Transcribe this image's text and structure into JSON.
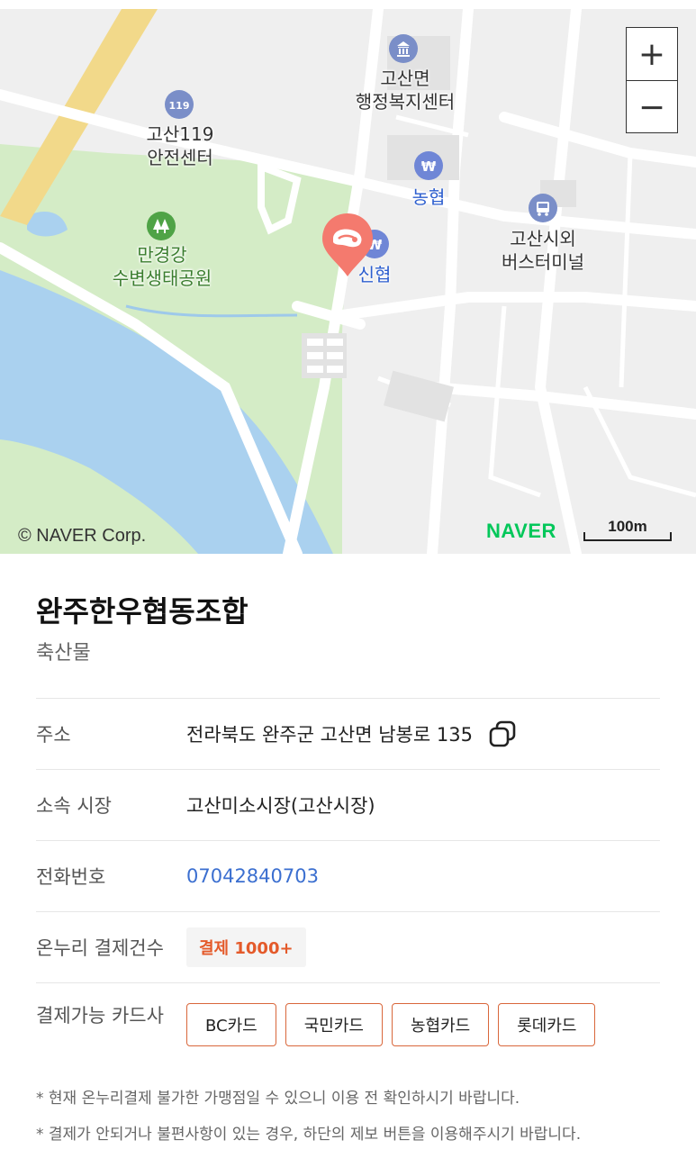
{
  "map": {
    "zoom_in_label": "+",
    "zoom_out_label": "−",
    "copyright": "© NAVER Corp.",
    "provider_logo": "NAVER",
    "scale_label": "100m",
    "pois": [
      {
        "id": "admin",
        "lines": [
          "고산면",
          "행정복지센터"
        ],
        "icon": "government-building-icon",
        "style": "normal"
      },
      {
        "id": "fire",
        "lines": [
          "고산119",
          "안전센터"
        ],
        "icon": "fire-station-icon",
        "style": "normal"
      },
      {
        "id": "park",
        "lines": [
          "만경강",
          "수변생태공원"
        ],
        "icon": "park-tree-icon",
        "style": "park"
      },
      {
        "id": "nh",
        "lines": [
          "농협"
        ],
        "icon": "bank-won-icon",
        "style": "blue"
      },
      {
        "id": "shinhyup",
        "lines": [
          "신협"
        ],
        "icon": "bank-icon",
        "style": "blue"
      },
      {
        "id": "bus",
        "lines": [
          "고산시외",
          "버스터미널"
        ],
        "icon": "bus-terminal-icon",
        "style": "normal"
      }
    ],
    "marker_icon": "meat-store-marker-icon",
    "colors": {
      "water": "#aad1ef",
      "park": "#d4ecc6",
      "road": "#ffffff",
      "highway": "#f2d98a",
      "marker": "#f47a6e"
    }
  },
  "store": {
    "name": "완주한우협동조합",
    "category": "축산물",
    "rows": [
      {
        "label": "주소",
        "value": "전라북도 완주군 고산면 남봉로 135"
      },
      {
        "label": "소속 시장",
        "value": "고산미소시장(고산시장)"
      },
      {
        "label": "전화번호",
        "value": "07042840703"
      },
      {
        "label": "온누리 결제건수",
        "value": "결제 1000+"
      }
    ],
    "cards_label": "결제가능 카드사",
    "cards": [
      "BC카드",
      "국민카드",
      "농협카드",
      "롯데카드"
    ]
  },
  "notes": [
    "* 현재 온누리결제 불가한 가맹점일 수 있으니 이용 전 확인하시기 바랍니다.",
    "* 결제가 안되거나 불편사항이 있는 경우, 하단의 제보 버튼을 이용해주시기 바랍니다."
  ]
}
